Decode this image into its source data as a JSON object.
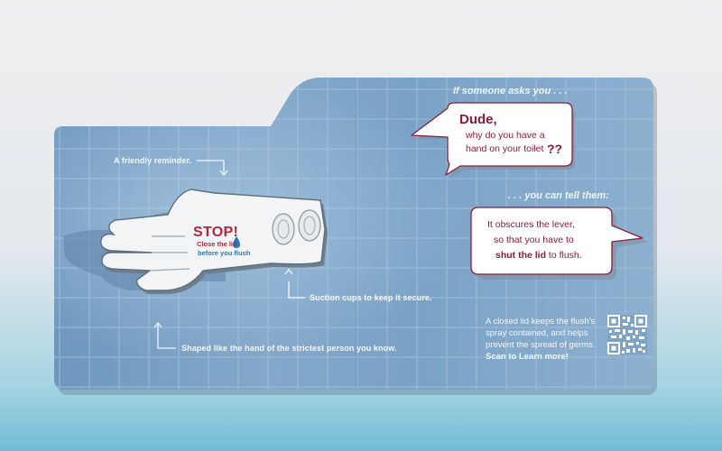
{
  "left_panel": {
    "reminder": "A friendly reminder.",
    "suction": "Suction cups to keep it secure.",
    "shape": "Shaped like the hand of the strictest person you know."
  },
  "hand_sign": {
    "stop": "STOP!",
    "line1": "Close the lid",
    "line2": "before you flush"
  },
  "right_panel": {
    "asks": "If someone asks you . . .",
    "bubble1": {
      "line1": "Dude,",
      "line2": "why do you have a",
      "line3": "hand on your toilet",
      "line4": "??"
    },
    "tell": ". . . you can tell them:",
    "bubble2": {
      "line1": "It obscures the lever,",
      "line2": "so that you have to",
      "line3_bold": "shut the lid",
      "line3_rest": " to flush."
    },
    "info": {
      "line1": "A closed lid keeps the flush’s",
      "line2": "spray contained, and helps",
      "line3": "prevent the spread of germs.",
      "line4": "Scan to Learn more!"
    }
  },
  "colors": {
    "board": "#7ea3c6",
    "accent": "#8b1c3a",
    "stop_red": "#b5273d",
    "blue_text": "#2c77b8"
  },
  "icons": [
    "arrow-icon",
    "water-drop-icon",
    "suction-cup-icon",
    "qr-code-icon"
  ]
}
